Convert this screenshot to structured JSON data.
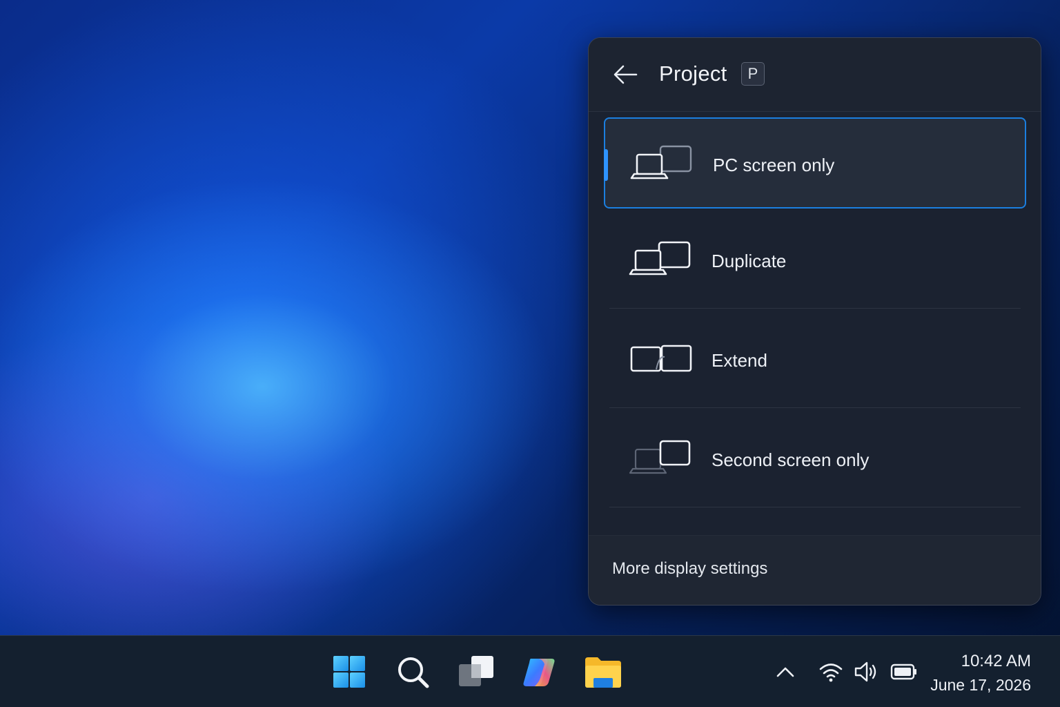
{
  "panel": {
    "title": "Project",
    "shortcut_key": "P",
    "back_icon": "arrow-left-icon",
    "options": [
      {
        "label": "PC screen only",
        "icon": "pc-screen-only-icon",
        "selected": true
      },
      {
        "label": "Duplicate",
        "icon": "duplicate-icon",
        "selected": false
      },
      {
        "label": "Extend",
        "icon": "extend-icon",
        "selected": false
      },
      {
        "label": "Second screen only",
        "icon": "second-screen-only-icon",
        "selected": false
      }
    ],
    "footer_link": "More display settings"
  },
  "taskbar": {
    "apps": [
      "start-icon",
      "search-icon",
      "task-view-icon",
      "copilot-icon",
      "file-explorer-icon"
    ],
    "tray": [
      "chevron-up-icon",
      "wifi-icon",
      "volume-icon",
      "battery-icon"
    ],
    "clock": {
      "time": "10:42 AM",
      "date": "June 17, 2026"
    }
  },
  "colors": {
    "accent": "#2e93ff",
    "panel_bg": "#1b2230",
    "taskbar_bg": "#14202f"
  }
}
